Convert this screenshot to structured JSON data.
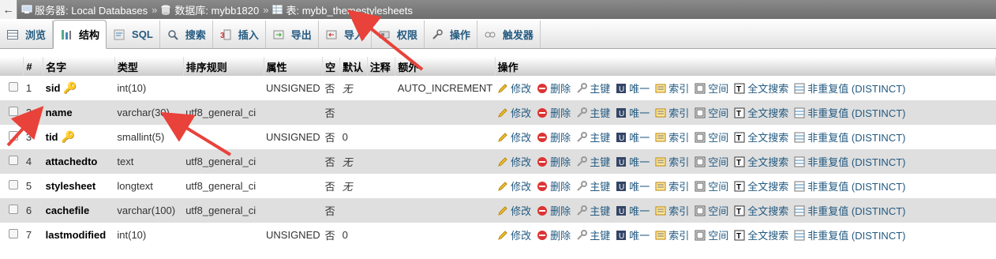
{
  "breadcrumb": {
    "lead_glyph": "←",
    "server": "服务器: Local Databases",
    "sep1": "»",
    "database": "数据库: mybb1820",
    "sep2": "»",
    "table": "表: mybb_themestylesheets"
  },
  "tabs": [
    {
      "label": "浏览"
    },
    {
      "label": "结构"
    },
    {
      "label": "SQL"
    },
    {
      "label": "搜索"
    },
    {
      "label": "插入"
    },
    {
      "label": "导出"
    },
    {
      "label": "导入"
    },
    {
      "label": "权限"
    },
    {
      "label": "操作"
    },
    {
      "label": "触发器"
    }
  ],
  "table": {
    "headers": {
      "num": "#",
      "name": "名字",
      "type": "类型",
      "collation": "排序规则",
      "attributes": "属性",
      "null": "空",
      "default": "默认",
      "comment": "注释",
      "extra": "额外",
      "actions": "操作"
    },
    "rows": [
      {
        "num": "1",
        "name": "sid",
        "type": "int(10)",
        "collation": "",
        "attributes": "UNSIGNED",
        "null": "否",
        "default": "无",
        "comment": "",
        "extra": "AUTO_INCREMENT"
      },
      {
        "num": "2",
        "name": "name",
        "type": "varchar(30)",
        "collation": "utf8_general_ci",
        "attributes": "",
        "null": "否",
        "default": "",
        "comment": "",
        "extra": ""
      },
      {
        "num": "3",
        "name": "tid",
        "type": "smallint(5)",
        "collation": "",
        "attributes": "UNSIGNED",
        "null": "否",
        "default": "0",
        "comment": "",
        "extra": ""
      },
      {
        "num": "4",
        "name": "attachedto",
        "type": "text",
        "collation": "utf8_general_ci",
        "attributes": "",
        "null": "否",
        "default": "无",
        "comment": "",
        "extra": ""
      },
      {
        "num": "5",
        "name": "stylesheet",
        "type": "longtext",
        "collation": "utf8_general_ci",
        "attributes": "",
        "null": "否",
        "default": "无",
        "comment": "",
        "extra": ""
      },
      {
        "num": "6",
        "name": "cachefile",
        "type": "varchar(100)",
        "collation": "utf8_general_ci",
        "attributes": "",
        "null": "否",
        "default": "",
        "comment": "",
        "extra": ""
      },
      {
        "num": "7",
        "name": "lastmodified",
        "type": "int(10)",
        "collation": "",
        "attributes": "UNSIGNED",
        "null": "否",
        "default": "0",
        "comment": "",
        "extra": ""
      }
    ],
    "actions": {
      "edit": "修改",
      "drop": "删除",
      "primary": "主键",
      "unique": "唯一",
      "index": "索引",
      "spatial": "空间",
      "fulltext": "全文搜索",
      "distinct": "非重复值 (DISTINCT)"
    }
  },
  "colors": {
    "accent_link": "#235a81",
    "annotation_arrow": "#e8423a",
    "row_stripe": "#dfdfdf"
  }
}
